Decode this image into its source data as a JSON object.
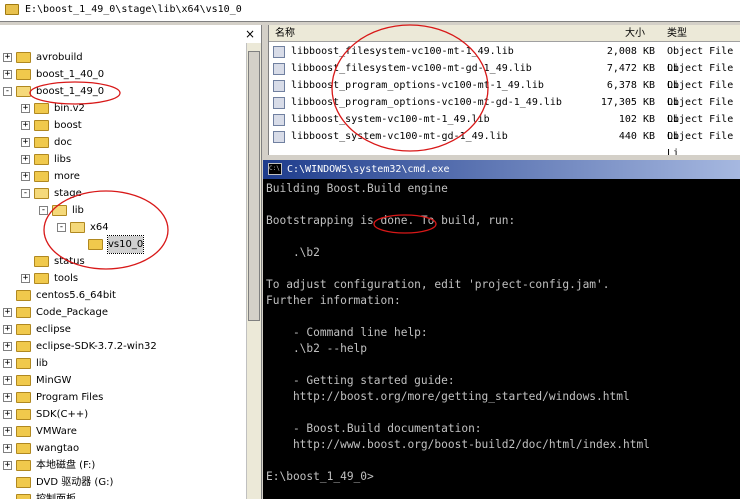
{
  "address": {
    "path": "E:\\boost_1_49_0\\stage\\lib\\x64\\vs10_0"
  },
  "tree": {
    "close_label": "×",
    "items": [
      {
        "label": "avrobuild",
        "exp": "+"
      },
      {
        "label": "boost_1_40_0",
        "exp": "+"
      },
      {
        "label": "boost_1_49_0",
        "exp": "-"
      },
      {
        "label": "bin.v2",
        "exp": "+"
      },
      {
        "label": "boost",
        "exp": "+"
      },
      {
        "label": "doc",
        "exp": "+"
      },
      {
        "label": "libs",
        "exp": "+"
      },
      {
        "label": "more",
        "exp": "+"
      },
      {
        "label": "stage",
        "exp": "-"
      },
      {
        "label": "lib",
        "exp": "-"
      },
      {
        "label": "x64",
        "exp": "-"
      },
      {
        "label": "vs10_0",
        "exp": ""
      },
      {
        "label": "status",
        "exp": ""
      },
      {
        "label": "tools",
        "exp": "+"
      },
      {
        "label": "centos5.6_64bit",
        "exp": ""
      },
      {
        "label": "Code_Package",
        "exp": "+"
      },
      {
        "label": "eclipse",
        "exp": "+"
      },
      {
        "label": "eclipse-SDK-3.7.2-win32",
        "exp": "+"
      },
      {
        "label": "lib",
        "exp": "+"
      },
      {
        "label": "MinGW",
        "exp": "+"
      },
      {
        "label": "Program Files",
        "exp": "+"
      },
      {
        "label": "SDK(C++)",
        "exp": "+"
      },
      {
        "label": "VMWare",
        "exp": "+"
      },
      {
        "label": "wangtao",
        "exp": "+"
      },
      {
        "label": "本地磁盘 (F:)",
        "exp": "+"
      },
      {
        "label": "DVD 驱动器 (G:)",
        "exp": ""
      },
      {
        "label": "控制面板",
        "exp": ""
      }
    ]
  },
  "files": {
    "columns": {
      "name": "名称",
      "size": "大小",
      "type": "类型"
    },
    "rows": [
      {
        "name": "libboost_filesystem-vc100-mt-1_49.lib",
        "size": "2,008 KB",
        "type": "Object File Li"
      },
      {
        "name": "libboost_filesystem-vc100-mt-gd-1_49.lib",
        "size": "7,472 KB",
        "type": "Object File Li"
      },
      {
        "name": "libboost_program_options-vc100-mt-1_49.lib",
        "size": "6,378 KB",
        "type": "Object File Li"
      },
      {
        "name": "libboost_program_options-vc100-mt-gd-1_49.lib",
        "size": "17,305 KB",
        "type": "Object File Li"
      },
      {
        "name": "libboost_system-vc100-mt-1_49.lib",
        "size": "102 KB",
        "type": "Object File Li"
      },
      {
        "name": "libboost_system-vc100-mt-gd-1_49.lib",
        "size": "440 KB",
        "type": "Object File Li"
      }
    ]
  },
  "cmd": {
    "title": "C:\\WINDOWS\\system32\\cmd.exe",
    "icon_text": "C:\\",
    "lines": [
      "Building Boost.Build engine",
      "",
      "Bootstrapping is done. To build, run:",
      "",
      "    .\\b2",
      "",
      "To adjust configuration, edit 'project-config.jam'.",
      "Further information:",
      "",
      "    - Command line help:",
      "    .\\b2 --help",
      "",
      "    - Getting started guide:",
      "    http://boost.org/more/getting_started/windows.html",
      "",
      "    - Boost.Build documentation:",
      "    http://www.boost.org/boost-build2/doc/html/index.html",
      "",
      "E:\\boost_1_49_0>"
    ]
  },
  "colors": {
    "annotation": "#d81818",
    "folder": "#f0c94c",
    "title_bar": "#1e3c8c"
  }
}
